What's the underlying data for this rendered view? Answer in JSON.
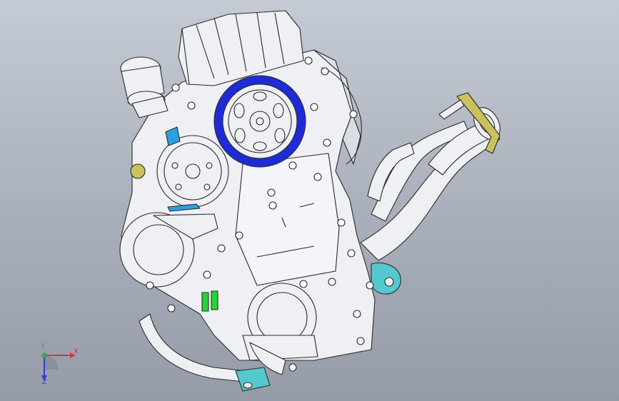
{
  "viewport": {
    "background_top": "#c5cbd4",
    "background_bottom": "#959ca8",
    "model": "engine-assembly-isometric"
  },
  "colors": {
    "line": "#2a2a2a",
    "shaded": "#eef0f4",
    "pulley_highlight": "#1f2bd6",
    "bracket_cyan": "#55c7cf",
    "clamp_green": "#27d436",
    "flange_yellow": "#c9c25a",
    "sensor_blue": "#2b9fe0"
  },
  "triad": {
    "x_label": "X",
    "y_label": "Y",
    "z_label": "Z",
    "x_color": "#d23a3a",
    "y_color": "#3aa64a",
    "z_color": "#2c3fd0"
  }
}
